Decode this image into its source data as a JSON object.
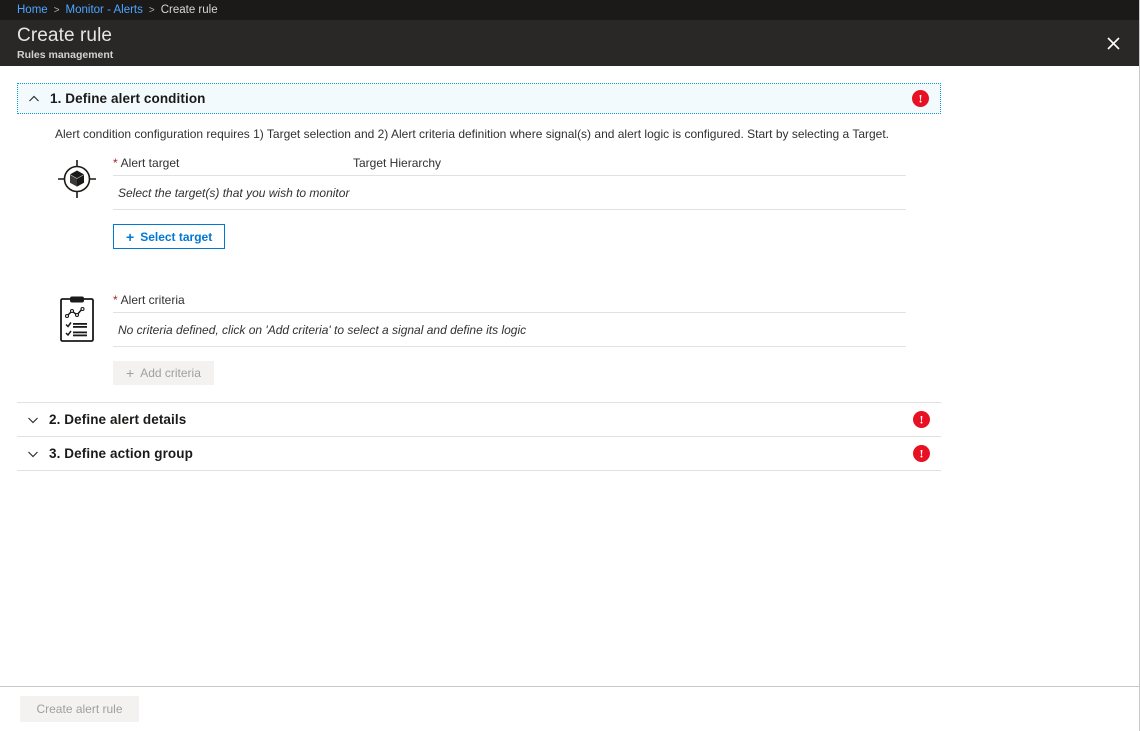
{
  "breadcrumb": {
    "items": [
      {
        "label": "Home",
        "link": true
      },
      {
        "label": "Monitor - Alerts",
        "link": true
      },
      {
        "label": "Create rule",
        "link": false
      }
    ],
    "separator": ">"
  },
  "header": {
    "title": "Create rule",
    "subtitle": "Rules management",
    "close_icon": "close-icon",
    "background": "#292827"
  },
  "colors": {
    "accent": "#0078d4",
    "error": "#e81123",
    "required_star": "#a4262c",
    "focus_outline": "#0f9bd7",
    "section_focus_bg": "#f2fafd",
    "link": "#4da6ff"
  },
  "sections": [
    {
      "number_label": "1. Define alert condition",
      "expanded": true,
      "chevron": "chevron-up-icon",
      "status_icon": "error-icon",
      "status_glyph": "!",
      "intro": "Alert condition configuration requires 1) Target selection and 2) Alert criteria definition where signal(s) and alert logic is configured. Start by selecting a Target.",
      "fields": [
        {
          "key": "alert_target",
          "icon": "target-resource-icon",
          "required": true,
          "label": "Alert target",
          "columns": [
            "Alert target",
            "Target Hierarchy"
          ],
          "empty_message": "Select the target(s) that you wish to monitor",
          "button": {
            "label": "Select target",
            "icon": "plus-icon",
            "disabled": false
          }
        },
        {
          "key": "alert_criteria",
          "icon": "criteria-clipboard-icon",
          "required": true,
          "label": "Alert criteria",
          "columns": [
            "Alert criteria"
          ],
          "empty_message": "No criteria defined, click on 'Add criteria' to select a signal and define its logic",
          "button": {
            "label": "Add criteria",
            "icon": "plus-icon",
            "disabled": true
          }
        }
      ]
    },
    {
      "number_label": "2. Define alert details",
      "expanded": false,
      "chevron": "chevron-down-icon",
      "status_icon": "error-icon",
      "status_glyph": "!"
    },
    {
      "number_label": "3. Define action group",
      "expanded": false,
      "chevron": "chevron-down-icon",
      "status_icon": "error-icon",
      "status_glyph": "!"
    }
  ],
  "footer": {
    "primary_button": {
      "label": "Create alert rule",
      "disabled": true
    }
  }
}
